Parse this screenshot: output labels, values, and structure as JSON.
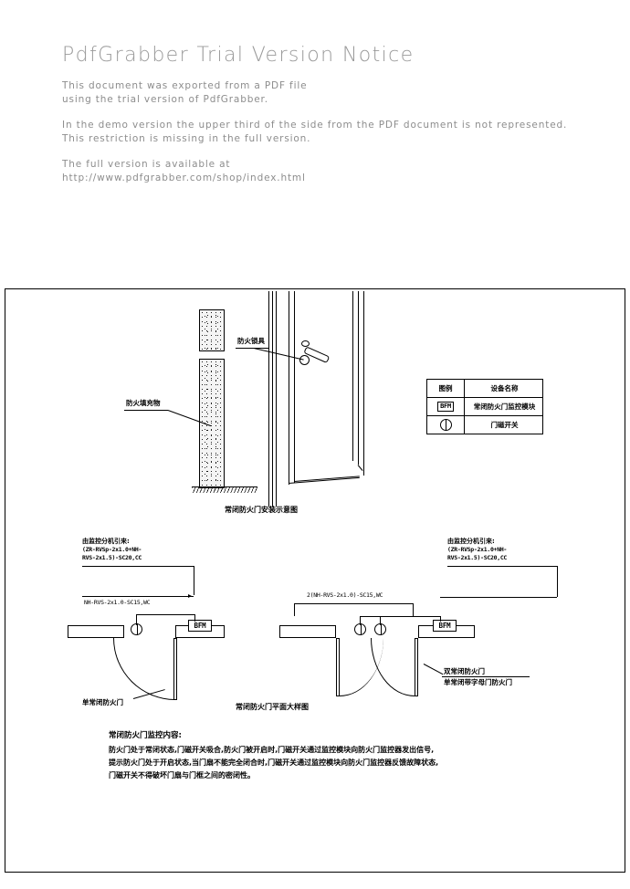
{
  "trial_notice": {
    "title": "PdfGrabber Trial Version Notice",
    "paragraph1": [
      "This document was exported from a PDF file",
      "using the trial version of PdfGrabber."
    ],
    "paragraph2": [
      "In the demo version the upper third of the side from the PDF document is not represented.",
      "This restriction is missing in the full version."
    ],
    "paragraph3": [
      "The full version is available at",
      "http://www.pdfgrabber.com/shop/index.html"
    ]
  },
  "drawing": {
    "elevation": {
      "label_lock": "防火锁具",
      "label_filler": "防火填充物",
      "caption": "常闭防火门安装示意图"
    },
    "legend": {
      "headers": [
        "图例",
        "设备名称"
      ],
      "rows": [
        {
          "symbol": "BFM",
          "symbol_type": "bfm-chip",
          "name": "常闭防火门监控模块"
        },
        {
          "symbol": "",
          "symbol_type": "magnet-circle",
          "name": "门磁开关"
        }
      ]
    },
    "plan": {
      "caption": "常闭防火门平面大样图",
      "left_annotation": {
        "title": "由监控分机引来:",
        "line1": "(ZR-RVSp-2x1.0+NH-",
        "line2": "RVS-2x1.5)-SC20,CC"
      },
      "right_annotation": {
        "title": "由监控分机引来:",
        "line1": "(ZR-RVSp-2x1.0+NH-",
        "line2": "RVS-2x1.5)-SC20,CC"
      },
      "left_cable_label": "NH-RVS-2x1.0-SC15,WC",
      "center_cable_label": "2(NH-RVS-2x1.0)-SC15,WC",
      "left_door_label": "单常闭防火门",
      "right_door_label_line1": "双常闭防火门",
      "right_door_label_line2": "单常闭带字母门防火门",
      "module_label": "BFM"
    },
    "note": {
      "title": "常闭防火门监控内容:",
      "lines": [
        "防火门处于常闭状态,门磁开关吸合,防火门被开启时,门磁开关通过监控模块向防火门监控器发出信号,",
        "提示防火门处于开启状态,当门扇不能完全闭合时,门磁开关通过监控模块向防火门监控器反馈故障状态,",
        "门磁开关不得破坏门扇与门框之间的密闭性。"
      ]
    }
  },
  "colors": {
    "line": "#000000",
    "notice_text": "#8d8d8d",
    "paper": "#ffffff",
    "wall_fill": "#f4f4f4"
  }
}
